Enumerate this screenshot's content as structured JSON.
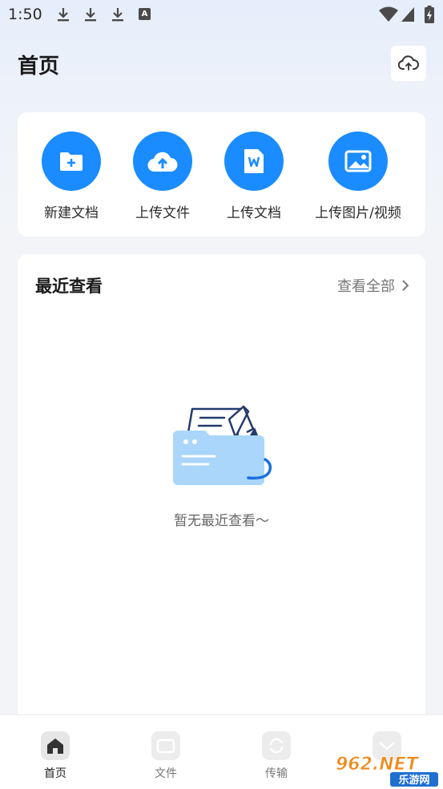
{
  "status_bar": {
    "time": "1:50",
    "notification_icons": [
      "download-icon",
      "download-icon",
      "download-icon",
      "accessibility-a-icon"
    ],
    "a_glyph": "A"
  },
  "header": {
    "title": "首页",
    "cloud_icon": "cloud-sync-icon"
  },
  "quick_actions": [
    {
      "label": "新建文档",
      "icon": "folder-plus-icon"
    },
    {
      "label": "上传文件",
      "icon": "cloud-upload-icon"
    },
    {
      "label": "上传文档",
      "icon": "word-doc-icon"
    },
    {
      "label": "上传图片/视频",
      "icon": "image-icon"
    }
  ],
  "recent": {
    "title": "最近查看",
    "view_all": "查看全部",
    "empty_text": "暂无最近查看～"
  },
  "tabbar": [
    {
      "label": "首页",
      "icon": "home-icon",
      "active": true
    },
    {
      "label": "文件",
      "icon": "folder-icon",
      "active": false
    },
    {
      "label": "传输",
      "icon": "transfer-icon",
      "active": false
    },
    {
      "label": "",
      "icon": "mine-icon",
      "active": false
    }
  ],
  "watermark": {
    "brand": "962.NET",
    "subtitle": "乐游网"
  },
  "colors": {
    "accent": "#1a8cff",
    "background": "#f2f4f8",
    "card": "#ffffff"
  }
}
